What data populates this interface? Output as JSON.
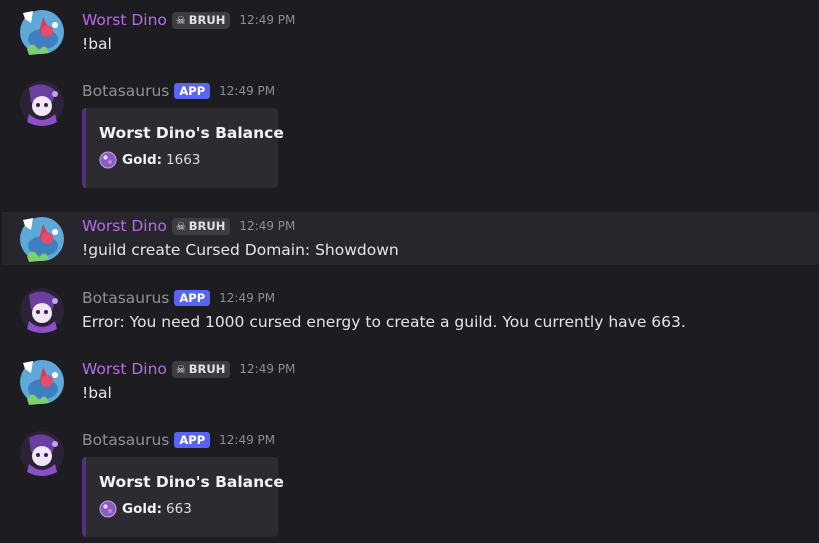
{
  "colors": {
    "background": "#1c1c21",
    "dino_name": "#b76be8",
    "bot_name": "#8f9097",
    "app_badge": "#5865f2",
    "embed_bar": "#582f7a"
  },
  "messages": [
    {
      "author": "Worst Dino",
      "tag": "BRUH",
      "tag_icon": "skull-icon",
      "time": "12:49 PM",
      "text": "!bal"
    },
    {
      "author": "Botasaurus",
      "badge": "APP",
      "time": "12:49 PM",
      "embed": {
        "title": "Worst Dino's Balance",
        "field_icon": "crystal-ball-icon",
        "field_label": "Gold:",
        "field_value": "1663"
      }
    },
    {
      "author": "Worst Dino",
      "tag": "BRUH",
      "tag_icon": "skull-icon",
      "time": "12:49 PM",
      "text": "!guild create Cursed Domain: Showdown"
    },
    {
      "author": "Botasaurus",
      "badge": "APP",
      "time": "12:49 PM",
      "text": "Error: You need 1000 cursed energy to create a guild. You currently have 663."
    },
    {
      "author": "Worst Dino",
      "tag": "BRUH",
      "tag_icon": "skull-icon",
      "time": "12:49 PM",
      "text": "!bal"
    },
    {
      "author": "Botasaurus",
      "badge": "APP",
      "time": "12:49 PM",
      "embed": {
        "title": "Worst Dino's Balance",
        "field_icon": "crystal-ball-icon",
        "field_label": "Gold:",
        "field_value": "663"
      }
    }
  ]
}
